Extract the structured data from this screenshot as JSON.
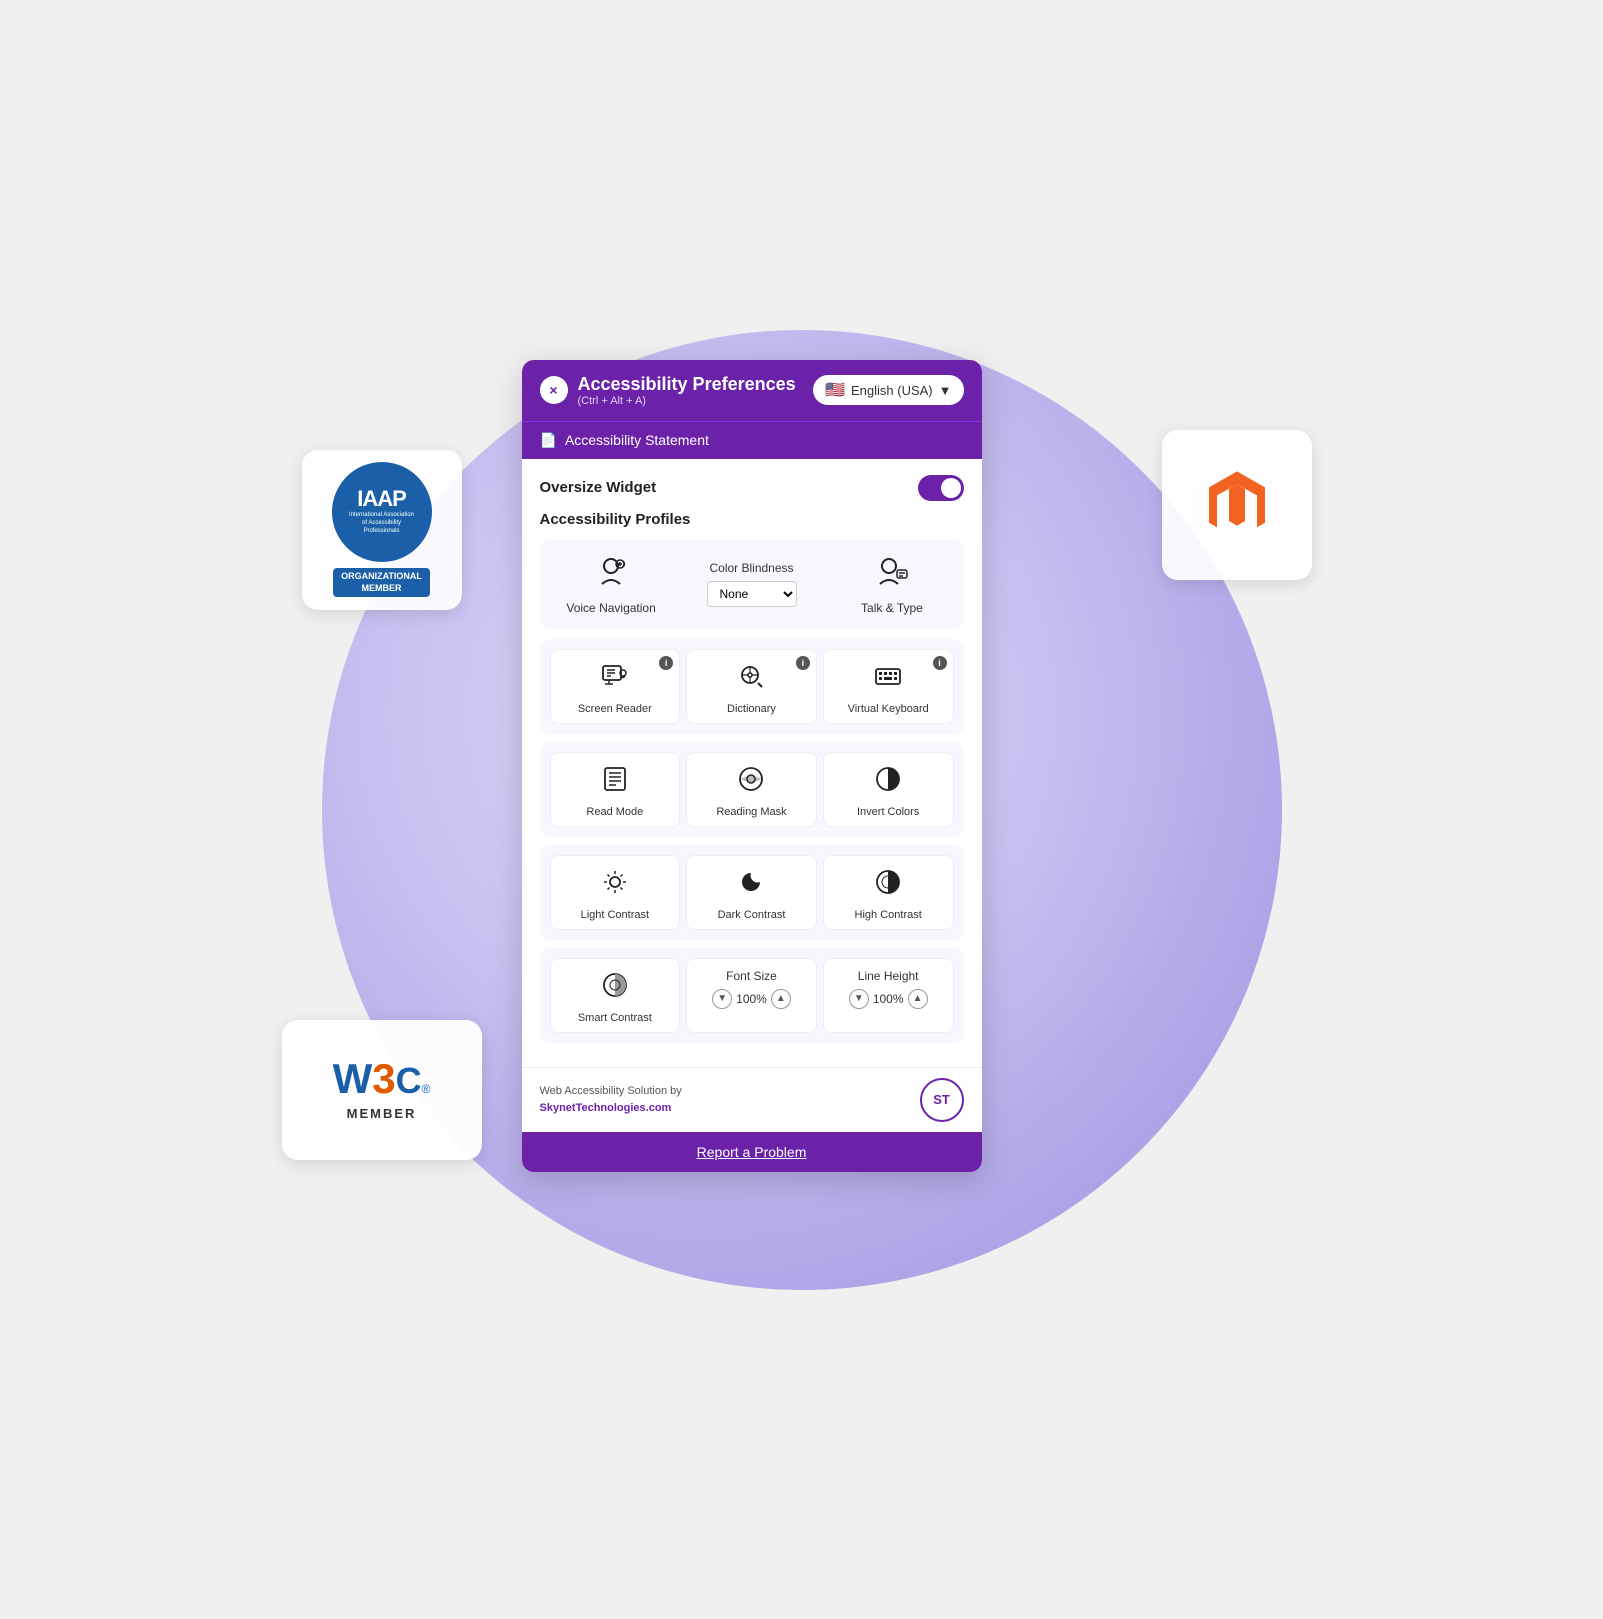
{
  "header": {
    "title": "Accessibility Preferences",
    "subtitle": "(Ctrl + Alt + A)",
    "close_label": "×",
    "lang_label": "English (USA)",
    "flag": "🇺🇸"
  },
  "statement_bar": {
    "icon": "📄",
    "label": "Accessibility Statement"
  },
  "oversize_widget": {
    "label": "Oversize Widget"
  },
  "profiles": {
    "label": "Accessibility Profiles",
    "items": [
      {
        "icon": "🗣",
        "label": "Voice Navigation"
      },
      {
        "icon": "💬",
        "label": "Talk & Type"
      }
    ],
    "color_blindness": {
      "label": "Color Blindness",
      "default": "None"
    }
  },
  "tools_row1": [
    {
      "icon": "📺",
      "label": "Screen Reader",
      "info": true
    },
    {
      "icon": "🔍",
      "label": "Dictionary",
      "info": true
    },
    {
      "icon": "⌨",
      "label": "Virtual Keyboard",
      "info": true
    }
  ],
  "tools_row2": [
    {
      "icon": "📰",
      "label": "Read Mode"
    },
    {
      "icon": "🌓",
      "label": "Reading Mask"
    },
    {
      "icon": "◑",
      "label": "Invert Colors"
    }
  ],
  "tools_row3": [
    {
      "icon": "☀",
      "label": "Light Contrast"
    },
    {
      "icon": "🌙",
      "label": "Dark Contrast"
    },
    {
      "icon": "◑",
      "label": "High Contrast"
    }
  ],
  "tools_row4": [
    {
      "icon": "◔",
      "label": "Smart Contrast"
    },
    {
      "label": "Font Size",
      "value": "100%",
      "type": "stepper"
    },
    {
      "label": "Line Height",
      "value": "100%",
      "type": "stepper"
    }
  ],
  "footer": {
    "text_line1": "Web Accessibility Solution by",
    "text_line2": "SkynetTechnologies.com",
    "logo_text": "ST"
  },
  "report_btn": {
    "label": "Report a Problem"
  },
  "iaap": {
    "main": "IAAP",
    "sub": "International Association\nof Accessibility\nProfessionals",
    "badge": "ORGANIZATIONAL\nMEMBER"
  },
  "w3c": {
    "logo": "W3C",
    "reg": "®",
    "member": "MEMBER"
  }
}
